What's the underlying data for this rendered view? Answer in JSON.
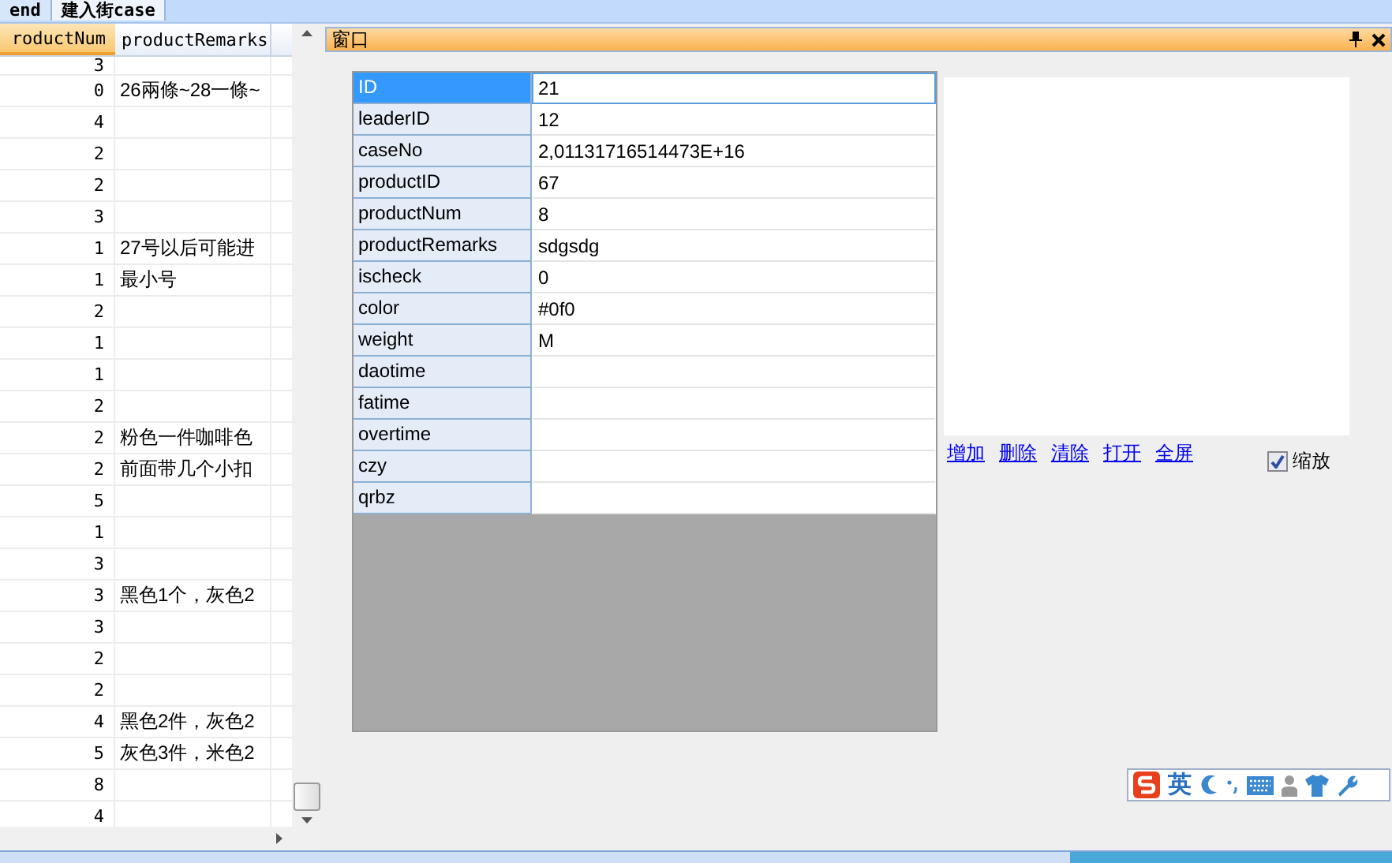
{
  "tabs": [
    {
      "label": "end",
      "selected": false
    },
    {
      "label": "建入街case",
      "selected": true
    }
  ],
  "grid": {
    "columns": [
      "roductNum",
      "productRemarks"
    ],
    "rows": [
      {
        "num": "3"
      },
      {
        "num": "0",
        "remarks": "26兩條~28一條~"
      },
      {
        "num": "4"
      },
      {
        "num": "2"
      },
      {
        "num": "2"
      },
      {
        "num": "3"
      },
      {
        "num": "1",
        "remarks": "27号以后可能进"
      },
      {
        "num": "1",
        "remarks": "最小号"
      },
      {
        "num": "2"
      },
      {
        "num": "1"
      },
      {
        "num": "1"
      },
      {
        "num": "2"
      },
      {
        "num": "2",
        "remarks": "粉色一件咖啡色"
      },
      {
        "num": "2",
        "remarks": "前面带几个小扣"
      },
      {
        "num": "5"
      },
      {
        "num": "1"
      },
      {
        "num": "3"
      },
      {
        "num": "3",
        "remarks": "黑色1个，灰色2"
      },
      {
        "num": "3"
      },
      {
        "num": "2"
      },
      {
        "num": "2"
      },
      {
        "num": "4",
        "remarks": "黑色2件，灰色2"
      },
      {
        "num": "5",
        "remarks": "灰色3件，米色2"
      },
      {
        "num": "8"
      },
      {
        "num": "4"
      }
    ]
  },
  "panel": {
    "title": "窗口",
    "properties": [
      {
        "name": "ID",
        "value": "21",
        "selected": true
      },
      {
        "name": "leaderID",
        "value": "12",
        "selected": false
      },
      {
        "name": "caseNo",
        "value": "2,01131716514473E+16",
        "selected": false
      },
      {
        "name": "productID",
        "value": "67",
        "selected": false
      },
      {
        "name": "productNum",
        "value": "8",
        "selected": false
      },
      {
        "name": "productRemarks",
        "value": "sdgsdg",
        "selected": false
      },
      {
        "name": "ischeck",
        "value": "0",
        "selected": false
      },
      {
        "name": "color",
        "value": "#0f0",
        "selected": false
      },
      {
        "name": "weight",
        "value": "M",
        "selected": false
      },
      {
        "name": "daotime",
        "selected": false
      },
      {
        "name": "fatime",
        "selected": false
      },
      {
        "name": "overtime",
        "selected": false
      },
      {
        "name": "czy",
        "selected": false
      },
      {
        "name": "qrbz",
        "selected": false
      }
    ],
    "links": [
      "增加",
      "删除",
      "清除",
      "打开",
      "全屏"
    ],
    "zoom_checkbox": {
      "label": "缩放",
      "checked": true
    }
  },
  "ime_toolbar": {
    "mode": "英"
  }
}
